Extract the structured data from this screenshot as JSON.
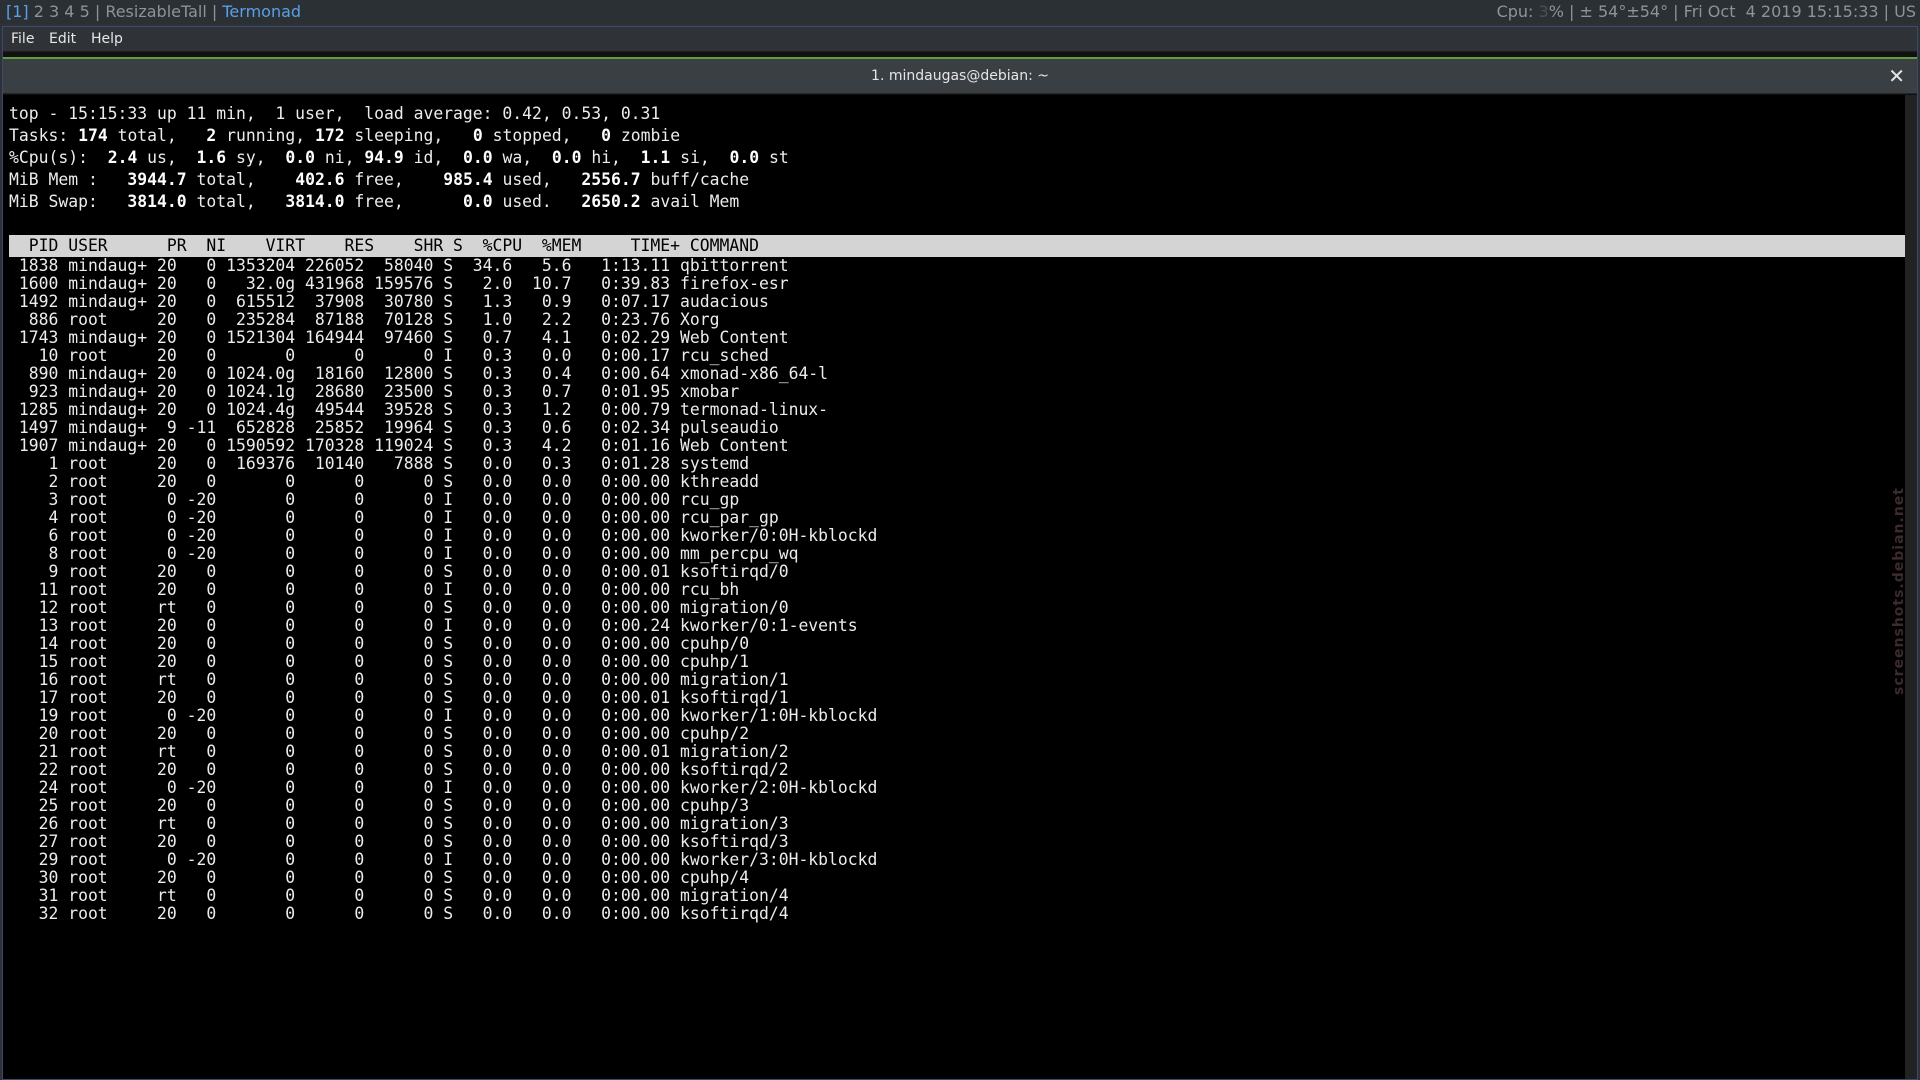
{
  "xmobar": {
    "workspace_current": "[1]",
    "workspaces_rest": "2 3 4 5",
    "layout": "ResizableTall",
    "window_name": "Termonad",
    "cpu_label": "Cpu: ",
    "cpu_value": "3",
    "cpu_suffix": "% | ± 54°±54° | Fri Oct  4 2019 15:15:33 | US"
  },
  "menu": {
    "file": "File",
    "edit": "Edit",
    "help": "Help"
  },
  "tab": {
    "title": "1. mindaugas@debian: ~",
    "close_glyph": "✕"
  },
  "summary": {
    "uptime_line": "top - 15:15:33 up 11 min,  1 user,  load average: 0.42, 0.53, 0.31",
    "tasks": {
      "label": "Tasks:",
      "total": "174",
      "running": "2",
      "sleeping": "172",
      "stopped": "0",
      "zombie": "0"
    },
    "cpu": {
      "label": "%Cpu(s):",
      "us": "2.4",
      "sy": "1.6",
      "ni": "0.0",
      "id": "94.9",
      "wa": "0.0",
      "hi": "0.0",
      "si": "1.1",
      "st": "0.0"
    },
    "mem": {
      "label": "MiB Mem :",
      "total": "3944.7",
      "free": "402.6",
      "used": "985.4",
      "buff_cache": "2556.7"
    },
    "swap": {
      "label": "MiB Swap:",
      "total": "3814.0",
      "free": "3814.0",
      "used": "0.0",
      "avail_mem": "2650.2"
    }
  },
  "columns": [
    "PID",
    "USER",
    "PR",
    "NI",
    "VIRT",
    "RES",
    "SHR",
    "S",
    "%CPU",
    "%MEM",
    "TIME+",
    "COMMAND"
  ],
  "processes": [
    [
      "1838",
      "mindaug+",
      "20",
      "0",
      "1353204",
      "226052",
      "58040",
      "S",
      "34.6",
      "5.6",
      "1:13.11",
      "qbittorrent"
    ],
    [
      "1600",
      "mindaug+",
      "20",
      "0",
      "32.0g",
      "431968",
      "159576",
      "S",
      "2.0",
      "10.7",
      "0:39.83",
      "firefox-esr"
    ],
    [
      "1492",
      "mindaug+",
      "20",
      "0",
      "615512",
      "37908",
      "30780",
      "S",
      "1.3",
      "0.9",
      "0:07.17",
      "audacious"
    ],
    [
      "886",
      "root",
      "20",
      "0",
      "235284",
      "87188",
      "70128",
      "S",
      "1.0",
      "2.2",
      "0:23.76",
      "Xorg"
    ],
    [
      "1743",
      "mindaug+",
      "20",
      "0",
      "1521304",
      "164944",
      "97460",
      "S",
      "0.7",
      "4.1",
      "0:02.29",
      "Web Content"
    ],
    [
      "10",
      "root",
      "20",
      "0",
      "0",
      "0",
      "0",
      "I",
      "0.3",
      "0.0",
      "0:00.17",
      "rcu_sched"
    ],
    [
      "890",
      "mindaug+",
      "20",
      "0",
      "1024.0g",
      "18160",
      "12800",
      "S",
      "0.3",
      "0.4",
      "0:00.64",
      "xmonad-x86_64-l"
    ],
    [
      "923",
      "mindaug+",
      "20",
      "0",
      "1024.1g",
      "28680",
      "23500",
      "S",
      "0.3",
      "0.7",
      "0:01.95",
      "xmobar"
    ],
    [
      "1285",
      "mindaug+",
      "20",
      "0",
      "1024.4g",
      "49544",
      "39528",
      "S",
      "0.3",
      "1.2",
      "0:00.79",
      "termonad-linux-"
    ],
    [
      "1497",
      "mindaug+",
      "9",
      "-11",
      "652828",
      "25852",
      "19964",
      "S",
      "0.3",
      "0.6",
      "0:02.34",
      "pulseaudio"
    ],
    [
      "1907",
      "mindaug+",
      "20",
      "0",
      "1590592",
      "170328",
      "119024",
      "S",
      "0.3",
      "4.2",
      "0:01.16",
      "Web Content"
    ],
    [
      "1",
      "root",
      "20",
      "0",
      "169376",
      "10140",
      "7888",
      "S",
      "0.0",
      "0.3",
      "0:01.28",
      "systemd"
    ],
    [
      "2",
      "root",
      "20",
      "0",
      "0",
      "0",
      "0",
      "S",
      "0.0",
      "0.0",
      "0:00.00",
      "kthreadd"
    ],
    [
      "3",
      "root",
      "0",
      "-20",
      "0",
      "0",
      "0",
      "I",
      "0.0",
      "0.0",
      "0:00.00",
      "rcu_gp"
    ],
    [
      "4",
      "root",
      "0",
      "-20",
      "0",
      "0",
      "0",
      "I",
      "0.0",
      "0.0",
      "0:00.00",
      "rcu_par_gp"
    ],
    [
      "6",
      "root",
      "0",
      "-20",
      "0",
      "0",
      "0",
      "I",
      "0.0",
      "0.0",
      "0:00.00",
      "kworker/0:0H-kblockd"
    ],
    [
      "8",
      "root",
      "0",
      "-20",
      "0",
      "0",
      "0",
      "I",
      "0.0",
      "0.0",
      "0:00.00",
      "mm_percpu_wq"
    ],
    [
      "9",
      "root",
      "20",
      "0",
      "0",
      "0",
      "0",
      "S",
      "0.0",
      "0.0",
      "0:00.01",
      "ksoftirqd/0"
    ],
    [
      "11",
      "root",
      "20",
      "0",
      "0",
      "0",
      "0",
      "I",
      "0.0",
      "0.0",
      "0:00.00",
      "rcu_bh"
    ],
    [
      "12",
      "root",
      "rt",
      "0",
      "0",
      "0",
      "0",
      "S",
      "0.0",
      "0.0",
      "0:00.00",
      "migration/0"
    ],
    [
      "13",
      "root",
      "20",
      "0",
      "0",
      "0",
      "0",
      "I",
      "0.0",
      "0.0",
      "0:00.24",
      "kworker/0:1-events"
    ],
    [
      "14",
      "root",
      "20",
      "0",
      "0",
      "0",
      "0",
      "S",
      "0.0",
      "0.0",
      "0:00.00",
      "cpuhp/0"
    ],
    [
      "15",
      "root",
      "20",
      "0",
      "0",
      "0",
      "0",
      "S",
      "0.0",
      "0.0",
      "0:00.00",
      "cpuhp/1"
    ],
    [
      "16",
      "root",
      "rt",
      "0",
      "0",
      "0",
      "0",
      "S",
      "0.0",
      "0.0",
      "0:00.00",
      "migration/1"
    ],
    [
      "17",
      "root",
      "20",
      "0",
      "0",
      "0",
      "0",
      "S",
      "0.0",
      "0.0",
      "0:00.01",
      "ksoftirqd/1"
    ],
    [
      "19",
      "root",
      "0",
      "-20",
      "0",
      "0",
      "0",
      "I",
      "0.0",
      "0.0",
      "0:00.00",
      "kworker/1:0H-kblockd"
    ],
    [
      "20",
      "root",
      "20",
      "0",
      "0",
      "0",
      "0",
      "S",
      "0.0",
      "0.0",
      "0:00.00",
      "cpuhp/2"
    ],
    [
      "21",
      "root",
      "rt",
      "0",
      "0",
      "0",
      "0",
      "S",
      "0.0",
      "0.0",
      "0:00.01",
      "migration/2"
    ],
    [
      "22",
      "root",
      "20",
      "0",
      "0",
      "0",
      "0",
      "S",
      "0.0",
      "0.0",
      "0:00.00",
      "ksoftirqd/2"
    ],
    [
      "24",
      "root",
      "0",
      "-20",
      "0",
      "0",
      "0",
      "I",
      "0.0",
      "0.0",
      "0:00.00",
      "kworker/2:0H-kblockd"
    ],
    [
      "25",
      "root",
      "20",
      "0",
      "0",
      "0",
      "0",
      "S",
      "0.0",
      "0.0",
      "0:00.00",
      "cpuhp/3"
    ],
    [
      "26",
      "root",
      "rt",
      "0",
      "0",
      "0",
      "0",
      "S",
      "0.0",
      "0.0",
      "0:00.00",
      "migration/3"
    ],
    [
      "27",
      "root",
      "20",
      "0",
      "0",
      "0",
      "0",
      "S",
      "0.0",
      "0.0",
      "0:00.00",
      "ksoftirqd/3"
    ],
    [
      "29",
      "root",
      "0",
      "-20",
      "0",
      "0",
      "0",
      "I",
      "0.0",
      "0.0",
      "0:00.00",
      "kworker/3:0H-kblockd"
    ],
    [
      "30",
      "root",
      "20",
      "0",
      "0",
      "0",
      "0",
      "S",
      "0.0",
      "0.0",
      "0:00.00",
      "cpuhp/4"
    ],
    [
      "31",
      "root",
      "rt",
      "0",
      "0",
      "0",
      "0",
      "S",
      "0.0",
      "0.0",
      "0:00.00",
      "migration/4"
    ],
    [
      "32",
      "root",
      "20",
      "0",
      "0",
      "0",
      "0",
      "S",
      "0.0",
      "0.0",
      "0:00.00",
      "ksoftirqd/4"
    ]
  ],
  "watermark": "screenshots.debian.net",
  "colors": {
    "accent": "#5aa0e6",
    "tab_indicator": "#5f9e3b",
    "header_bg": "#d4d4d4"
  }
}
